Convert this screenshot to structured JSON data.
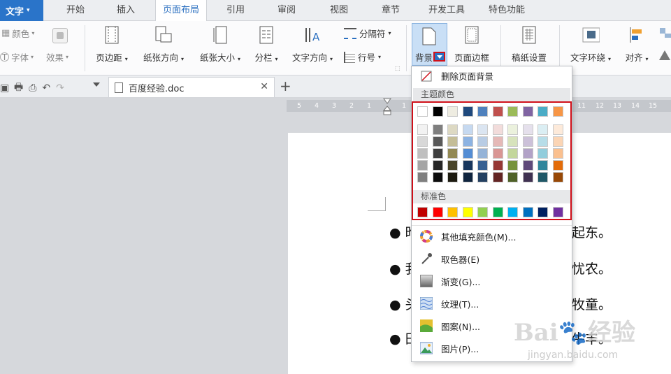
{
  "app": {
    "menu_label": "文字"
  },
  "tabs": [
    "开始",
    "插入",
    "页面布局",
    "引用",
    "审阅",
    "视图",
    "章节",
    "开发工具",
    "特色功能"
  ],
  "active_tab": "页面布局",
  "ribbon": {
    "color_label": "颜色",
    "font_label": "字体",
    "effect_label": "效果",
    "margins": "页边距",
    "orientation": "纸张方向",
    "size": "纸张大小",
    "columns": "分栏",
    "text_direction": "文字方向",
    "separator": "分隔符",
    "line_number": "行号",
    "background": "背景",
    "page_border": "页面边框",
    "paper_setting": "稿纸设置",
    "text_wrap": "文字环绕",
    "align": "对齐"
  },
  "doc_tab": {
    "name": "百度经验.doc"
  },
  "ruler": {
    "left": [
      "5",
      "4",
      "3",
      "2",
      "1"
    ],
    "right": [
      "11",
      "12",
      "13",
      "14",
      "15"
    ],
    "right_partial": "1"
  },
  "document": {
    "lines": [
      {
        "start": "昨",
        "end": "起东。"
      },
      {
        "start": "我",
        "end": "忧农。"
      },
      {
        "start": "头",
        "end": "牧童。"
      },
      {
        "start": "田",
        "end": "牛丰。"
      }
    ]
  },
  "menu": {
    "remove_bg": "删除页面背景",
    "theme_header": "主题颜色",
    "standard_header": "标准色",
    "more_colors": "其他填充颜色(M)...",
    "eyedropper": "取色器(E)",
    "gradient": "渐变(G)...",
    "texture": "纹理(T)...",
    "pattern": "图案(N)...",
    "picture": "图片(P)..."
  },
  "colors": {
    "theme_top": [
      "#ffffff",
      "#000000",
      "#eeece1",
      "#1f497d",
      "#4f81bd",
      "#c0504d",
      "#9bbb59",
      "#8064a2",
      "#4bacc6",
      "#f79646"
    ],
    "theme_shades": [
      [
        "#f2f2f2",
        "#7f7f7f",
        "#ddd9c3",
        "#c6d9f0",
        "#dbe5f1",
        "#f2dcdb",
        "#ebf1dd",
        "#e5e0ec",
        "#dbeef3",
        "#fdeada"
      ],
      [
        "#d8d8d8",
        "#595959",
        "#c4bd97",
        "#8db3e2",
        "#b8cce4",
        "#e5b9b7",
        "#d7e3bc",
        "#ccc1d9",
        "#b7dde8",
        "#fbd5b5"
      ],
      [
        "#bfbfbf",
        "#3f3f3f",
        "#938953",
        "#548dd4",
        "#95b3d7",
        "#d99694",
        "#c3d69b",
        "#b2a2c7",
        "#92cddc",
        "#fac08f"
      ],
      [
        "#a5a5a5",
        "#262626",
        "#494429",
        "#17365d",
        "#366092",
        "#953734",
        "#76923c",
        "#5f497a",
        "#31859b",
        "#e36c09"
      ],
      [
        "#7f7f7f",
        "#0c0c0c",
        "#1d1b10",
        "#0f243e",
        "#244061",
        "#632423",
        "#4f6128",
        "#3f3151",
        "#205867",
        "#974806"
      ]
    ],
    "standard": [
      "#c00000",
      "#ff0000",
      "#ffc000",
      "#ffff00",
      "#92d050",
      "#00b050",
      "#00b0f0",
      "#0070c0",
      "#002060",
      "#7030a0"
    ],
    "accent": "#2a74c9",
    "highlight": "#d0101a"
  },
  "watermark": {
    "brand": "Bai",
    "brand_cn": "经验",
    "url": "jingyan.baidu.com"
  }
}
